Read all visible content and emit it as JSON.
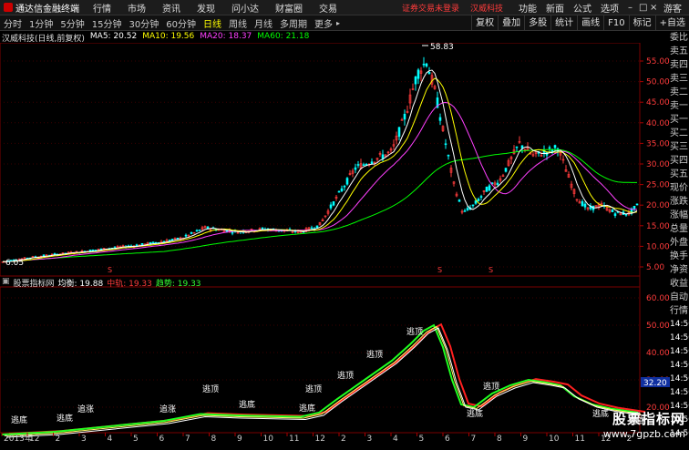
{
  "menubar": {
    "app_title": "通达信金融终端",
    "menus": [
      "行情",
      "市场",
      "资讯",
      "发现",
      "问小达",
      "财富圈",
      "交易"
    ],
    "alert": "证券交易未登录",
    "stock_name_red": "汉威科技",
    "right_items": [
      "功能",
      "新面",
      "公式",
      "选项"
    ],
    "user": "游客"
  },
  "toolbar": {
    "periods": [
      "分时",
      "1分钟",
      "5分钟",
      "15分钟",
      "30分钟",
      "60分钟",
      "日线",
      "周线",
      "月线",
      "多周期",
      "更多"
    ],
    "active_period": "日线",
    "right_items": [
      "复权",
      "叠加",
      "多股",
      "统计",
      "画线",
      "F10",
      "标记",
      "+自选"
    ]
  },
  "info": {
    "title": "汉威科技(日线,前复权)",
    "ma5": "MA5: 20.52",
    "ma10": "MA10: 19.56",
    "ma20": "MA20: 18.37",
    "ma60": "MA60: 21.18"
  },
  "price_axis": [
    "55.00",
    "50.00",
    "45.00",
    "40.00",
    "35.00",
    "30.00",
    "25.00",
    "20.00",
    "15.00",
    "10.00",
    "5.00"
  ],
  "peak_label": "58.83",
  "low_label": "6.05",
  "indicator": {
    "name": "股票指标网",
    "avg": "均衡: 19.88",
    "mid_label": "中轨: 19.33",
    "trend_label": "趋势: 19.33",
    "axis": [
      "60.00",
      "50.00",
      "40.00",
      "30.00",
      "20.00"
    ],
    "highlight": "32.20"
  },
  "stage_labels": {
    "top": "逃顶",
    "bottom": "逃底",
    "follow": "追涨"
  },
  "time_axis": [
    "2013年",
    "12",
    "2",
    "3",
    "4",
    "5",
    "6",
    "7",
    "8",
    "9",
    "10",
    "11",
    "12",
    "2",
    "3",
    "4",
    "5",
    "6",
    "7",
    "8",
    "9",
    "10",
    "11",
    "12",
    "2"
  ],
  "right_panel": {
    "items": [
      "委比",
      "卖五",
      "卖四",
      "卖三",
      "卖二",
      "卖一",
      "买一",
      "买二",
      "买三",
      "买四",
      "买五",
      "现价",
      "涨跌",
      "涨幅",
      "总量",
      "外盘",
      "换手",
      "净资",
      "收益"
    ],
    "lower_title": "自动",
    "lower_sub": "行情",
    "times": [
      "14:50",
      "14:50",
      "14:50",
      "14:50",
      "14:50",
      "14:50",
      "14:50",
      "14:50",
      "14:50"
    ]
  },
  "watermark": {
    "big": "股票指标网",
    "small": "www.7gpzb.com"
  },
  "colors": {
    "ma5": "#ffffff",
    "ma10": "#ffff00",
    "ma20": "#ff40ff",
    "ma60": "#00ff00",
    "up": "#ff3b3b",
    "down": "#00ffff"
  }
}
